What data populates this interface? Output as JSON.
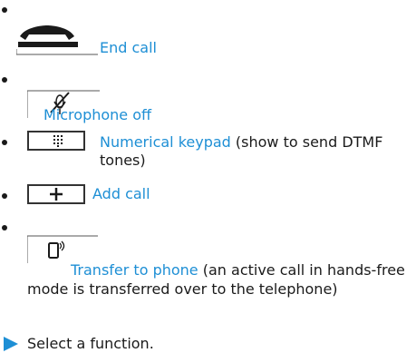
{
  "functions": [
    {
      "icon": "end-call-icon",
      "label": "End call"
    },
    {
      "icon": "microphone-off-icon",
      "label": "Microphone off"
    },
    {
      "icon": "numerical-keypad-icon",
      "label": "Numerical keypad",
      "note": "(show to send DTMF tones)"
    },
    {
      "icon": "add-call-icon",
      "label": "Add call"
    },
    {
      "icon": "transfer-to-phone-icon",
      "label": "Transfer to phone",
      "note": "(an active call in hands-free mode is transferred over to the telephone)"
    }
  ],
  "instruction": "Select a function.",
  "colors": {
    "link": "#1e8fd5",
    "text": "#1a1a1a"
  }
}
